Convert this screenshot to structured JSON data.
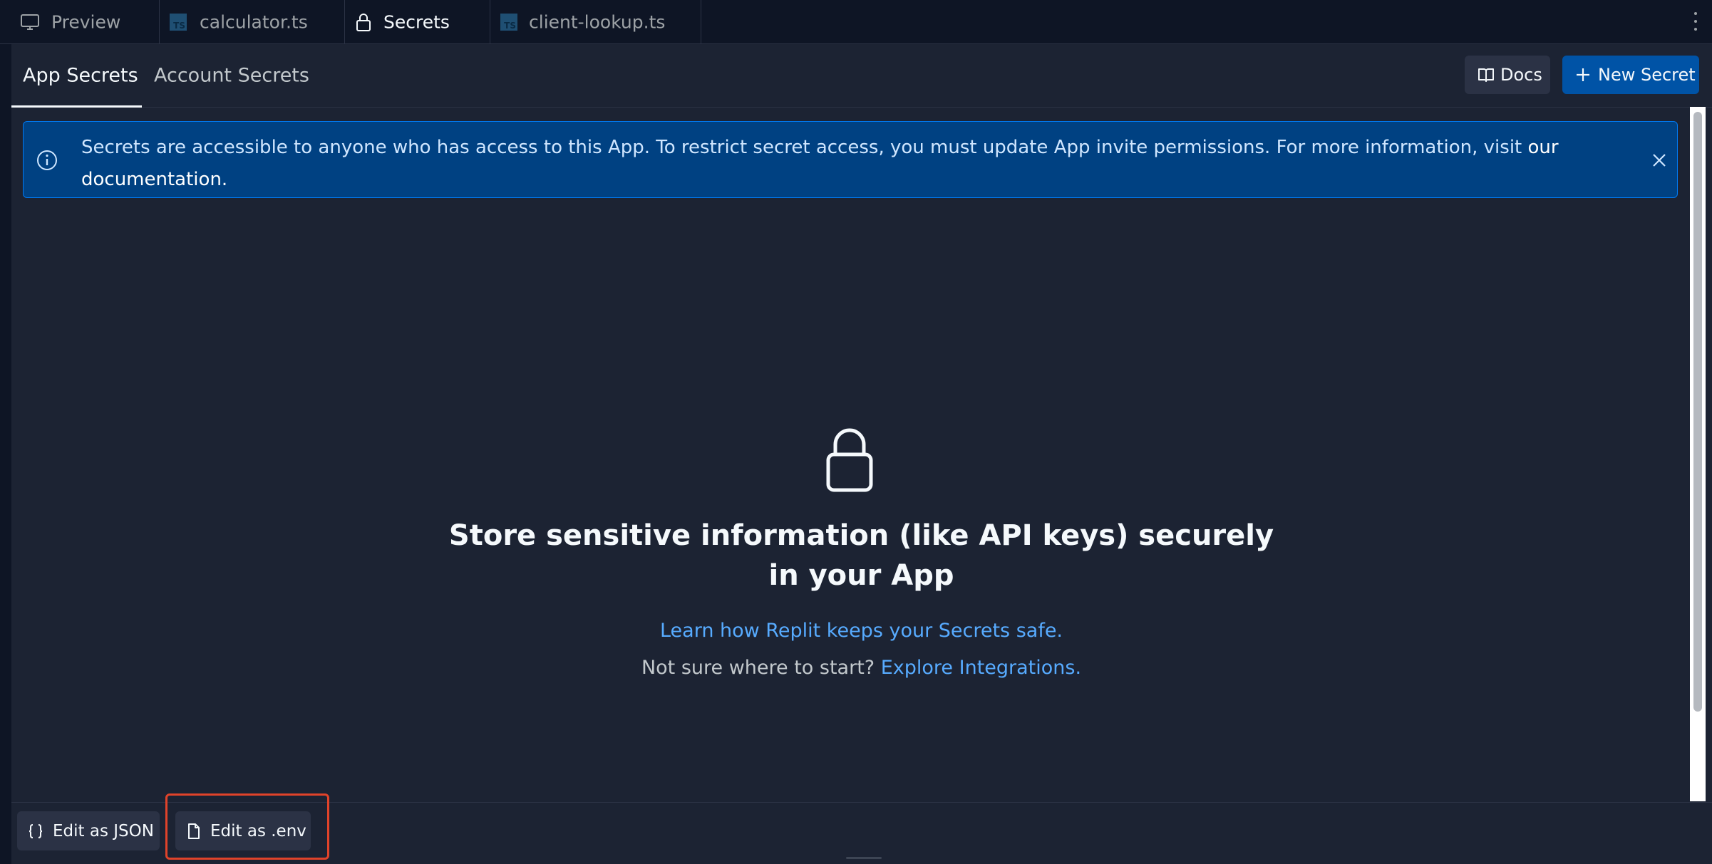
{
  "tabs": [
    {
      "label": "Preview",
      "icon": "monitor-icon",
      "active": false
    },
    {
      "label": "calculator.ts",
      "icon": "typescript-icon",
      "active": false
    },
    {
      "label": "Secrets",
      "icon": "lock-icon",
      "active": true
    },
    {
      "label": "client-lookup.ts",
      "icon": "typescript-icon",
      "active": false
    }
  ],
  "ts_badge": "TS",
  "subtabs": {
    "app_secrets": "App Secrets",
    "account_secrets": "Account Secrets"
  },
  "header_buttons": {
    "docs": "Docs",
    "new_secret": "New Secret"
  },
  "banner": {
    "message": "Secrets are accessible to anyone who has access to this App. To restrict secret access, you must update App invite permissions. For more information, visit",
    "link": "our documentation."
  },
  "empty_state": {
    "title": "Store sensitive information (like API keys) securely in your App",
    "learn_link": "Learn how Replit keeps your Secrets safe.",
    "start_prefix": "Not sure where to start?",
    "start_link": "Explore Integrations."
  },
  "footer": {
    "edit_json": "Edit as JSON",
    "edit_env": "Edit as .env"
  },
  "colors": {
    "background": "#0e1525",
    "panel": "#1c2333",
    "accent": "#0053a6",
    "link": "#57abff",
    "highlight": "#e0432a"
  }
}
